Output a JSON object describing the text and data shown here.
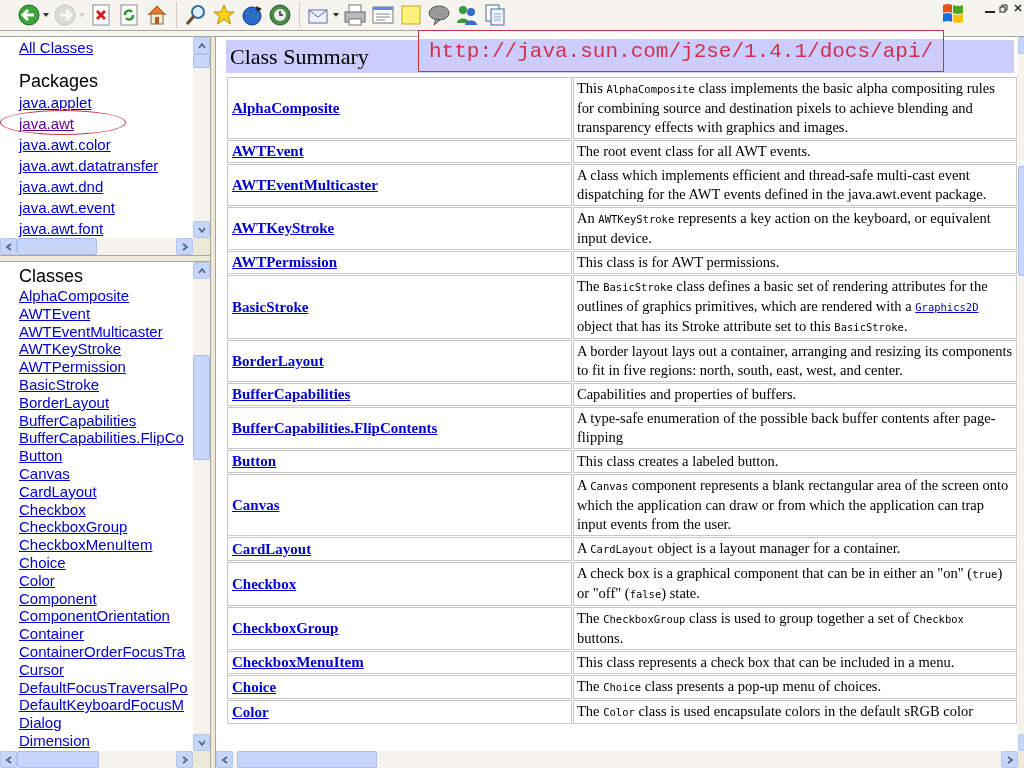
{
  "toolbar": {
    "groups": [
      {
        "buttons": [
          {
            "kind": "back",
            "disabled": false,
            "menu": true
          },
          {
            "kind": "forward",
            "disabled": true,
            "menu": true
          },
          {
            "kind": "stop",
            "disabled": false,
            "menu": false
          },
          {
            "kind": "refresh",
            "disabled": false,
            "menu": false
          },
          {
            "kind": "home",
            "disabled": false,
            "menu": false
          }
        ]
      },
      {
        "buttons": [
          {
            "kind": "search",
            "disabled": false,
            "menu": false
          },
          {
            "kind": "favorites",
            "disabled": false,
            "menu": false
          },
          {
            "kind": "media",
            "disabled": false,
            "menu": false
          },
          {
            "kind": "history",
            "disabled": false,
            "menu": false
          }
        ]
      },
      {
        "buttons": [
          {
            "kind": "mail",
            "disabled": false,
            "menu": true
          },
          {
            "kind": "print",
            "disabled": false,
            "menu": false
          },
          {
            "kind": "edit",
            "disabled": false,
            "menu": false
          },
          {
            "kind": "note",
            "disabled": false,
            "menu": false
          },
          {
            "kind": "discuss",
            "disabled": false,
            "menu": false
          },
          {
            "kind": "messenger",
            "disabled": false,
            "menu": false
          },
          {
            "kind": "copy",
            "disabled": false,
            "menu": false
          }
        ]
      }
    ]
  },
  "window_controls": [
    {
      "kind": "minimize"
    },
    {
      "kind": "restore"
    },
    {
      "kind": "close"
    }
  ],
  "packages_frame": {
    "all_classes": "All Classes",
    "heading": "Packages",
    "items": [
      {
        "label": "java.applet",
        "visited": false,
        "circled": false
      },
      {
        "label": "java.awt",
        "visited": true,
        "circled": true
      },
      {
        "label": "java.awt.color",
        "visited": false,
        "circled": false
      },
      {
        "label": "java.awt.datatransfer",
        "visited": false,
        "circled": false
      },
      {
        "label": "java.awt.dnd",
        "visited": false,
        "circled": false
      },
      {
        "label": "java.awt.event",
        "visited": false,
        "circled": false
      },
      {
        "label": "java.awt.font",
        "visited": false,
        "circled": false
      }
    ]
  },
  "classes_frame": {
    "heading": "Classes",
    "items": [
      "AlphaComposite",
      "AWTEvent",
      "AWTEventMulticaster",
      "AWTKeyStroke",
      "AWTPermission",
      "BasicStroke",
      "BorderLayout",
      "BufferCapabilities",
      "BufferCapabilities.FlipCo",
      "Button",
      "Canvas",
      "CardLayout",
      "Checkbox",
      "CheckboxGroup",
      "CheckboxMenuItem",
      "Choice",
      "Color",
      "Component",
      "ComponentOrientation",
      "Container",
      "ContainerOrderFocusTra",
      "Cursor",
      "DefaultFocusTraversalPo",
      "DefaultKeyboardFocusM",
      "Dialog",
      "Dimension"
    ]
  },
  "class_summary": {
    "title": "Class Summary",
    "annotation_url": "http://java.sun.com/j2se/1.4.1/docs/api/",
    "rows": [
      {
        "name": "AlphaComposite",
        "description": [
          {
            "kind": "text",
            "text": "This "
          },
          {
            "kind": "code",
            "text": "AlphaComposite"
          },
          {
            "kind": "text",
            "text": " class implements the basic alpha compositing rules for combining source and destination pixels to achieve blending and transparency effects with graphics and images."
          }
        ]
      },
      {
        "name": "AWTEvent",
        "description": [
          {
            "kind": "text",
            "text": "The root event class for all AWT events."
          }
        ]
      },
      {
        "name": "AWTEventMulticaster",
        "description": [
          {
            "kind": "text",
            "text": "A class which implements efficient and thread-safe multi-cast event dispatching for the AWT events defined in the java.awt.event package."
          }
        ]
      },
      {
        "name": "AWTKeyStroke",
        "description": [
          {
            "kind": "text",
            "text": "An "
          },
          {
            "kind": "code",
            "text": "AWTKeyStroke"
          },
          {
            "kind": "text",
            "text": " represents a key action on the keyboard, or equivalent input device."
          }
        ]
      },
      {
        "name": "AWTPermission",
        "description": [
          {
            "kind": "text",
            "text": "This class is for AWT permissions."
          }
        ]
      },
      {
        "name": "BasicStroke",
        "description": [
          {
            "kind": "text",
            "text": "The "
          },
          {
            "kind": "code",
            "text": "BasicStroke"
          },
          {
            "kind": "text",
            "text": " class defines a basic set of rendering attributes for the outlines of graphics primitives, which are rendered with a "
          },
          {
            "kind": "link",
            "text": "Graphics2D"
          },
          {
            "kind": "text",
            "text": " object that has its Stroke attribute set to this "
          },
          {
            "kind": "code",
            "text": "BasicStroke"
          },
          {
            "kind": "text",
            "text": "."
          }
        ]
      },
      {
        "name": "BorderLayout",
        "description": [
          {
            "kind": "text",
            "text": "A border layout lays out a container, arranging and resizing its components to fit in five regions: north, south, east, west, and center."
          }
        ]
      },
      {
        "name": "BufferCapabilities",
        "description": [
          {
            "kind": "text",
            "text": "Capabilities and properties of buffers."
          }
        ]
      },
      {
        "name": "BufferCapabilities.FlipContents",
        "description": [
          {
            "kind": "text",
            "text": "A type-safe enumeration of the possible back buffer contents after page-flipping"
          }
        ]
      },
      {
        "name": "Button",
        "description": [
          {
            "kind": "text",
            "text": "This class creates a labeled button."
          }
        ]
      },
      {
        "name": "Canvas",
        "description": [
          {
            "kind": "text",
            "text": "A "
          },
          {
            "kind": "code",
            "text": "Canvas"
          },
          {
            "kind": "text",
            "text": " component represents a blank rectangular area of the screen onto which the application can draw or from which the application can trap input events from the user."
          }
        ]
      },
      {
        "name": "CardLayout",
        "description": [
          {
            "kind": "text",
            "text": "A "
          },
          {
            "kind": "code",
            "text": "CardLayout"
          },
          {
            "kind": "text",
            "text": " object is a layout manager for a container."
          }
        ]
      },
      {
        "name": "Checkbox",
        "description": [
          {
            "kind": "text",
            "text": "A check box is a graphical component that can be in either an \"on\" ("
          },
          {
            "kind": "code",
            "text": "true"
          },
          {
            "kind": "text",
            "text": ") or \"off\" ("
          },
          {
            "kind": "code",
            "text": "false"
          },
          {
            "kind": "text",
            "text": ") state."
          }
        ]
      },
      {
        "name": "CheckboxGroup",
        "description": [
          {
            "kind": "text",
            "text": "The "
          },
          {
            "kind": "code",
            "text": "CheckboxGroup"
          },
          {
            "kind": "text",
            "text": " class is used to group together a set of "
          },
          {
            "kind": "code",
            "text": "Checkbox"
          },
          {
            "kind": "text",
            "text": " buttons."
          }
        ]
      },
      {
        "name": "CheckboxMenuItem",
        "description": [
          {
            "kind": "text",
            "text": "This class represents a check box that can be included in a menu."
          }
        ]
      },
      {
        "name": "Choice",
        "description": [
          {
            "kind": "text",
            "text": "The "
          },
          {
            "kind": "code",
            "text": "Choice"
          },
          {
            "kind": "text",
            "text": " class presents a pop-up menu of choices."
          }
        ]
      },
      {
        "name": "Color",
        "description": [
          {
            "kind": "text",
            "text": "The "
          },
          {
            "kind": "code",
            "text": "Color"
          },
          {
            "kind": "text",
            "text": " class is used encapsulate colors in the default sRGB color"
          }
        ]
      }
    ]
  }
}
